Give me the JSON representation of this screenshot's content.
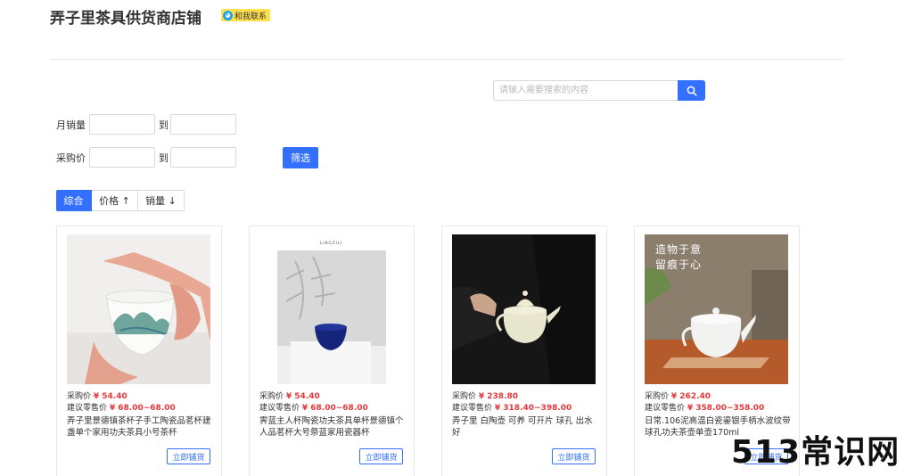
{
  "shop": {
    "title": "弄子里茶具供货商店铺",
    "contact_label": "和我联系"
  },
  "search": {
    "placeholder": "请输入需要搜索的内容"
  },
  "filters": {
    "monthly_sales_label": "月销量",
    "purchase_price_label": "采购价",
    "to_label": "到",
    "filter_button": "筛选"
  },
  "sort": {
    "items": [
      "综合",
      "价格 ↑",
      "销量 ↓"
    ]
  },
  "products": [
    {
      "purchase_label": "采购价",
      "purchase_price": "¥ 54.40",
      "retail_label": "建议零售价",
      "retail_price": "¥ 68.00~68.00",
      "name": "弄子里景德镇茶杯子手工陶瓷品茗杯建盏单个家用功夫茶具小号茶杯",
      "button": "立即铺货"
    },
    {
      "purchase_label": "采购价",
      "purchase_price": "¥ 54.40",
      "retail_label": "建议零售价",
      "retail_price": "¥ 68.00~68.00",
      "name": "霁蓝主人杯陶瓷功夫茶具单杯景德镇个人品茗杯大号祭蓝家用瓷器杯",
      "button": "立即铺货",
      "brand_text": "LINGZILI"
    },
    {
      "purchase_label": "采购价",
      "purchase_price": "¥ 238.80",
      "retail_label": "建议零售价",
      "retail_price": "¥ 318.40~398.00",
      "name": "弄子里 白陶壶 可养 可开片 球孔 出水好",
      "button": "立即铺货"
    },
    {
      "purchase_label": "采购价",
      "purchase_price": "¥ 262.40",
      "retail_label": "建议零售价",
      "retail_price": "¥ 358.00~358.00",
      "name": "日常.106泥高温白瓷鎏银手柄水波纹带球孔功夫茶壶单壶170ml",
      "button": "立即铺货",
      "image_text_1": "造物于意",
      "image_text_2": "留痕于心"
    }
  ],
  "watermark": "513常识网",
  "colors": {
    "accent": "#3370ff",
    "price_red": "#e4393c"
  }
}
